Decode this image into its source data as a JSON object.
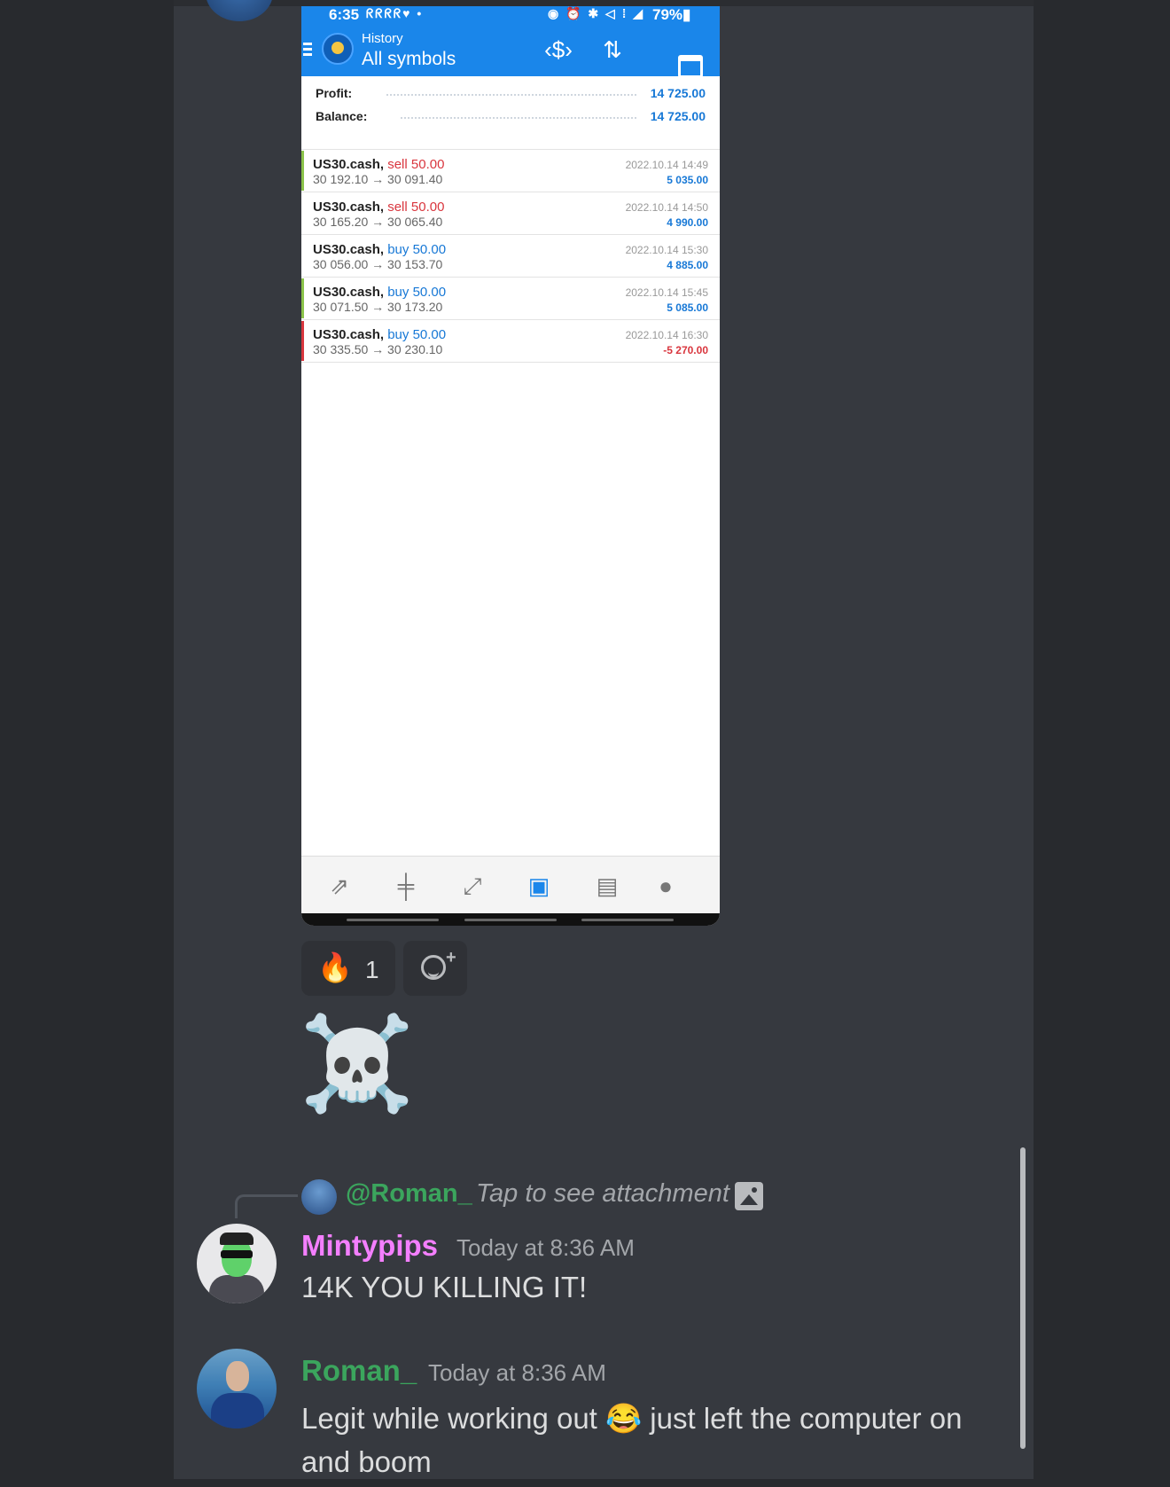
{
  "phone": {
    "status": {
      "time": "6:35",
      "icons_left": "ᖇᖇᖇᖇ♥ •",
      "icons_right": "◉ ⏰ ✱ ◁ ⁞ ◢",
      "battery": "79%▮"
    },
    "appbar": {
      "subtitle": "History",
      "title": "All symbols",
      "icons": [
        "currency-swap-icon",
        "sort-icon",
        "calendar-icon"
      ]
    },
    "summary": {
      "profit_label": "Profit:",
      "profit_value": "14 725.00",
      "balance_label": "Balance:",
      "balance_value": "14 725.00"
    },
    "trades": [
      {
        "symbol": "US30.cash,",
        "side": "sell 50.00",
        "side_color": "#d9363e",
        "prices": "30 192.10 → 30 091.40",
        "datetime": "2022.10.14 14:49",
        "pl": "5 035.00",
        "pl_color": "#1778d6",
        "bar_color": "#8bc34a"
      },
      {
        "symbol": "US30.cash,",
        "side": "sell 50.00",
        "side_color": "#d9363e",
        "prices": "30 165.20 → 30 065.40",
        "datetime": "2022.10.14 14:50",
        "pl": "4 990.00",
        "pl_color": "#1778d6",
        "bar_color": "#ffffff"
      },
      {
        "symbol": "US30.cash,",
        "side": "buy 50.00",
        "side_color": "#1778d6",
        "prices": "30 056.00 → 30 153.70",
        "datetime": "2022.10.14 15:30",
        "pl": "4 885.00",
        "pl_color": "#1778d6",
        "bar_color": "#ffffff"
      },
      {
        "symbol": "US30.cash,",
        "side": "buy 50.00",
        "side_color": "#1778d6",
        "prices": "30 071.50 → 30 173.20",
        "datetime": "2022.10.14 15:45",
        "pl": "5 085.00",
        "pl_color": "#1778d6",
        "bar_color": "#8bc34a"
      },
      {
        "symbol": "US30.cash,",
        "side": "buy 50.00",
        "side_color": "#1778d6",
        "prices": "30 335.50 → 30 230.10",
        "datetime": "2022.10.14 16:30",
        "pl": "-5 270.00",
        "pl_color": "#d9363e",
        "bar_color": "#d9363e"
      }
    ],
    "bottom_nav": [
      {
        "name": "quotes-icon",
        "glyph": "⇗"
      },
      {
        "name": "chart-candles-icon",
        "glyph": "╪"
      },
      {
        "name": "trade-icon",
        "glyph": "⤢"
      },
      {
        "name": "history-inbox-icon",
        "glyph": "▣",
        "active": true
      },
      {
        "name": "news-icon",
        "glyph": "▤"
      },
      {
        "name": "messages-icon",
        "glyph": "●"
      }
    ]
  },
  "reactions": [
    {
      "emoji": "🔥",
      "count": "1"
    }
  ],
  "add_reaction_icon": "add-reaction-icon",
  "big_emoji": "☠️",
  "reply": {
    "name": "@Roman_",
    "text": "Tap to see attachment"
  },
  "messages": [
    {
      "username": "Mintypips",
      "name_color": "#f47fff",
      "timestamp": "Today at 8:36 AM",
      "line1": "14K YOU KILLING IT!"
    },
    {
      "username": "Roman_",
      "name_color": "#3ba55d",
      "timestamp": "Today at 8:36 AM",
      "line1": "Legit while working out 😂 just left the computer on",
      "line2": "and boom"
    }
  ],
  "colors": {
    "background": "#36393f",
    "mt5_blue": "#1a86ea"
  }
}
